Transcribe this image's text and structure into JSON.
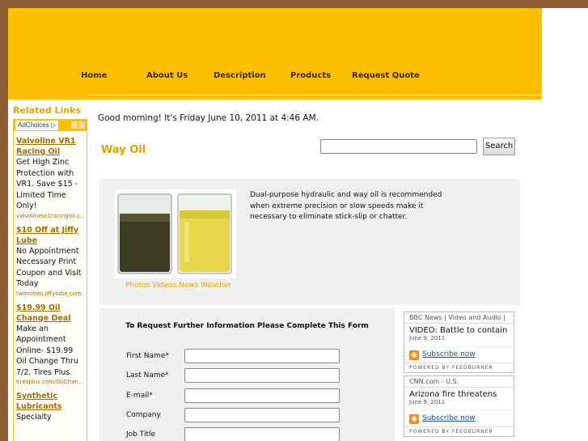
{
  "nav": {
    "items": [
      "Home",
      "About Us",
      "Description",
      "Products",
      "Request Quote"
    ]
  },
  "sidebar": {
    "title": "Related Links",
    "adchoices": "AdChoices ▷",
    "ads": [
      {
        "title": "Valvoline VR1 Racing Oil",
        "body": "Get High Zinc Protection with VR1. Save $15 - Limited Time Only!",
        "url": "valvolinevr1racingoil.c..."
      },
      {
        "title": "$10 Off at Jiffy Lube",
        "body": "No Appointment Necessary Print Coupon and Visit Today",
        "url": "twincities.jiffylube.com..."
      },
      {
        "title": "$19.99 Oil Change Deal",
        "body": "Make an Appointment Online- $19.99 Oil Change Thru 7/2. Tires Plus.",
        "url": "tiresplus.com/OilChan..."
      },
      {
        "title": "Synthetic Lubricants",
        "body": "Specialty",
        "url": ""
      }
    ]
  },
  "greeting": "Good morning! It's Friday June 10, 2011 at 4:46 AM.",
  "page_title": "Way Oil",
  "search": {
    "button": "Search",
    "value": ""
  },
  "product": {
    "photo_links": "Photos Videos News Weather",
    "description": "Dual-purpose hydraulic and way oil is recommended when extreme precision or slow speeds make it necessary to eliminate stick-slip or chatter."
  },
  "form": {
    "title": "To Request Further Information Please Complete This Form",
    "fields": [
      "First Name*",
      "Last Name*",
      "E-mail*",
      "Company",
      "Job Title"
    ]
  },
  "feeds": [
    {
      "source": "BBC News | Video and Audio |",
      "headline": "VIDEO: Battle to contain",
      "date": "June 9, 2011",
      "subscribe": "Subscribe now",
      "powered": "POWERED BY FEEDBURNER"
    },
    {
      "source": "CNN.com - U.S.",
      "headline": "Arizona fire threatens",
      "date": "June 9, 2011",
      "subscribe": "Subscribe now",
      "powered": "POWERED BY FEEDBURNER"
    }
  ]
}
